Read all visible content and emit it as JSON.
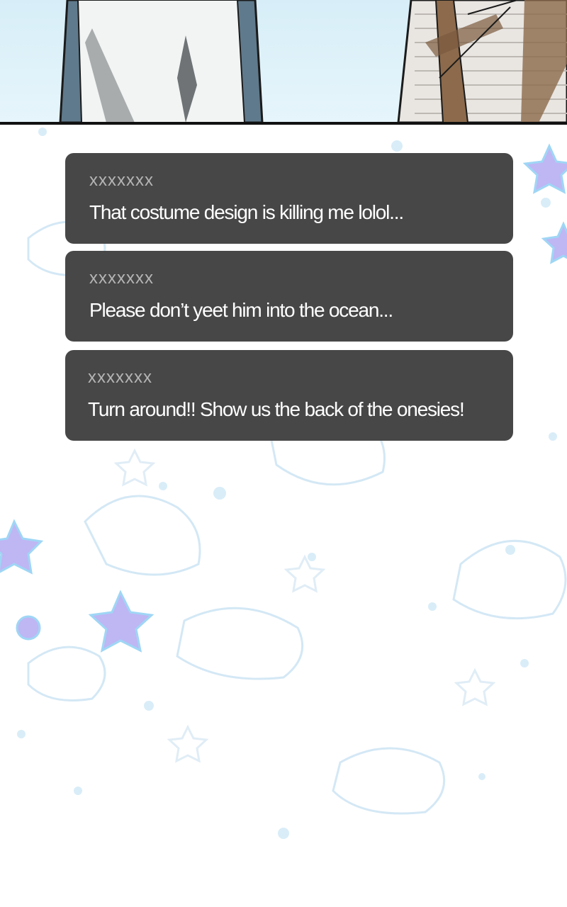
{
  "colors": {
    "bubble_bg": "#474747",
    "username": "#b5b5b5",
    "comment_text": "#ffffff",
    "pattern": "#cfe6f4",
    "star": "#bfb6f4"
  },
  "comments": [
    {
      "user": "xxxxxxx",
      "text": "That costume design is killing me lolol..."
    },
    {
      "user": "xxxxxxx",
      "text": "Please don’t yeet him into the ocean..."
    },
    {
      "user": "xxxxxxx",
      "text": "Turn around!! Show us the back of the onesies!"
    }
  ]
}
